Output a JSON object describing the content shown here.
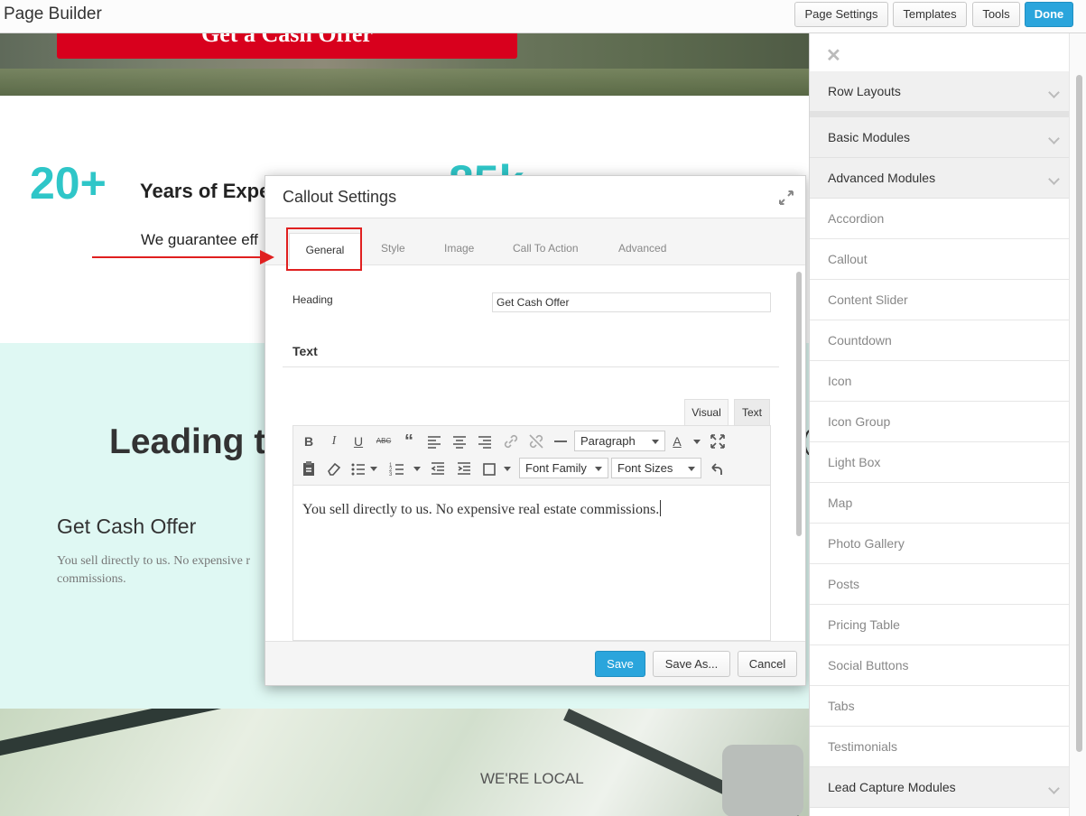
{
  "topbar": {
    "title": "Page Builder",
    "buttons": {
      "page_settings": "Page Settings",
      "templates": "Templates",
      "tools": "Tools",
      "done": "Done"
    }
  },
  "page": {
    "hero_cta": "Get a Cash Offer",
    "stat1_value": "20+",
    "stat1_label": "Years of Expe",
    "guarantee": "We guarantee eff",
    "stat2_value": "85k",
    "leading": "Leading t",
    "paren": "(",
    "callout_heading": "Get Cash Offer",
    "callout_text": "You sell directly to us. No expensive r commissions.",
    "local_label": "WE'RE LOCAL"
  },
  "modal": {
    "title": "Callout Settings",
    "tabs": [
      "General",
      "Style",
      "Image",
      "Call To Action",
      "Advanced"
    ],
    "heading_label": "Heading",
    "heading_value": "Get Cash Offer",
    "text_section": "Text",
    "editor_tabs": {
      "visual": "Visual",
      "text": "Text"
    },
    "toolbar": {
      "paragraph": "Paragraph",
      "font_family": "Font Family",
      "font_sizes": "Font Sizes"
    },
    "editor_content": "You sell directly to us. No expensive real estate commissions.",
    "buttons": {
      "save": "Save",
      "save_as": "Save As...",
      "cancel": "Cancel"
    }
  },
  "panel": {
    "sections": {
      "row_layouts": "Row Layouts",
      "basic_modules": "Basic Modules",
      "advanced_modules": "Advanced Modules",
      "lead_capture": "Lead Capture Modules"
    },
    "items": [
      "Accordion",
      "Callout",
      "Content Slider",
      "Countdown",
      "Icon",
      "Icon Group",
      "Light Box",
      "Map",
      "Photo Gallery",
      "Posts",
      "Pricing Table",
      "Social Buttons",
      "Tabs",
      "Testimonials"
    ]
  },
  "colors": {
    "accent_blue": "#2aa5dc",
    "stat_teal": "#2fc6c8",
    "cta_red": "#d8001d",
    "annotation_red": "#e02020",
    "mint_bg": "#dff8f3"
  }
}
